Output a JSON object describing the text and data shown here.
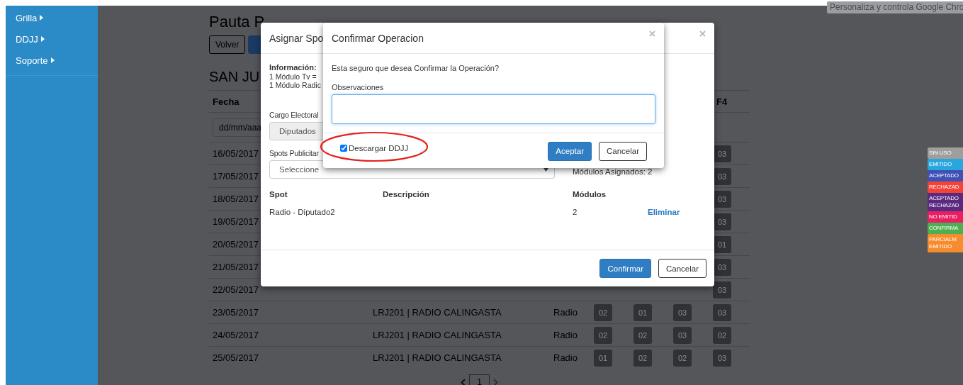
{
  "browser_tooltip": {
    "text": "Personaliza y controla Google Chro"
  },
  "sidebar": {
    "items": [
      {
        "label": "Grilla"
      },
      {
        "label": "DDJJ"
      },
      {
        "label": "Soporte"
      }
    ]
  },
  "page": {
    "title": "Pauta P",
    "buttons": [
      {
        "kind": "outline",
        "label": "Volver"
      },
      {
        "kind": "primary"
      }
    ],
    "section_title": "SAN JU",
    "table": {
      "columns": [
        {
          "kind": "date",
          "label": "Fecha"
        },
        {
          "kind": "module",
          "label": "F4"
        }
      ],
      "filter": {
        "placeholder": "dd/mm/aaa"
      },
      "rows": [
        {
          "date": "16/05/2017",
          "modules": [
            "03"
          ]
        },
        {
          "date": "17/05/2017",
          "modules": [
            "03"
          ]
        },
        {
          "date": "18/05/2017",
          "modules": [
            "03"
          ]
        },
        {
          "date": "19/05/2017",
          "modules": [
            "03"
          ]
        },
        {
          "date": "20/05/2017",
          "modules": [
            "01"
          ]
        },
        {
          "date": "21/05/2017",
          "modules": [
            "03"
          ]
        },
        {
          "date": "22/05/2017",
          "modules": [
            "03"
          ]
        },
        {
          "date": "23/05/2017",
          "station": "LRJ201 | RADIO CALINGASTA",
          "medium": "Radio",
          "modules": [
            "02",
            "01",
            "03",
            "03"
          ]
        },
        {
          "date": "24/05/2017",
          "station": "LRJ201 | RADIO CALINGASTA",
          "medium": "Radio",
          "modules": [
            "02",
            "02",
            "03",
            "02"
          ]
        },
        {
          "date": "25/05/2017",
          "station": "LRJ201 | RADIO CALINGASTA",
          "medium": "Radio",
          "modules": [
            "01",
            "02",
            "02",
            "03"
          ]
        }
      ]
    },
    "pagination": {
      "page": "1"
    }
  },
  "legend": [
    {
      "label": "SIN USO",
      "color": "#9e9e9e"
    },
    {
      "label": "EMITIDO",
      "color": "#2aa6de"
    },
    {
      "label": "ACEPTADO",
      "color": "#3f51b5"
    },
    {
      "label": "RECHAZAD",
      "color": "#f44336"
    },
    {
      "label": "ACEPTADO RECHAZAD",
      "color": "#5b2a80"
    },
    {
      "label": "NO EMITID",
      "color": "#e91e63"
    },
    {
      "label": "CONFIRMA",
      "color": "#4caf50"
    },
    {
      "label": "PARCIALM EMITIDO",
      "color": "#f68c2e"
    }
  ],
  "modal_assign": {
    "title": "Asignar Spo",
    "info_label": "Información:",
    "info_lines": [
      "1 Módulo Tv =",
      "1 Módulo Radic"
    ],
    "cargo_label": "Cargo Electoral",
    "cargo_select": {
      "value": "Diputados",
      "disabled": true
    },
    "spots_label": "Spots Publicitar",
    "spots_select": {
      "value": "Seleccione",
      "disabled": false
    },
    "assigned": "Módulos Asignados: 2",
    "columns": [
      "Spot",
      "Descripción",
      "Módulos"
    ],
    "rows": [
      {
        "spot": "Radio - Diputado2",
        "modules": "2",
        "action": "Eliminar"
      }
    ],
    "buttons": [
      {
        "kind": "primary",
        "label": "Confirmar"
      },
      {
        "kind": "outline",
        "label": "Cancelar"
      }
    ]
  },
  "modal_confirm": {
    "title": "Confirmar Operacion",
    "message": "Esta seguro que desea Confirmar la Operación?",
    "observaciones_label": "Observaciones",
    "observaciones": {
      "focused": true
    },
    "checkbox": {
      "label": "Descargar DDJJ",
      "checked": true
    },
    "buttons": [
      {
        "kind": "primary",
        "label": "Aceptar"
      },
      {
        "kind": "outline",
        "label": "Cancelar"
      }
    ]
  },
  "annotations": [
    {
      "kind": "ellipse"
    }
  ]
}
